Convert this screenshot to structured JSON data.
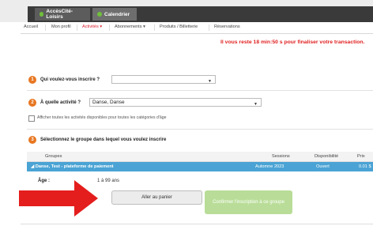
{
  "tabs": [
    {
      "label": "AccèsCité-Loisirs"
    },
    {
      "label": "Calendrier"
    }
  ],
  "menu": [
    {
      "label": "Accueil"
    },
    {
      "label": "Mon profil"
    },
    {
      "label": "Activités ▾"
    },
    {
      "label": "Abonnements ▾"
    },
    {
      "label": "Produits / Billetterie"
    },
    {
      "label": "Réservations"
    }
  ],
  "timer_text": "Il vous reste 18 min:50 s pour finaliser votre transaction.",
  "step1": {
    "number": "1",
    "label": "Qui voulez-vous inscrire ?",
    "value": ""
  },
  "step2": {
    "number": "2",
    "label": "À quelle activité ?",
    "value": "Danse, Danse"
  },
  "checkbox_label": "Afficher toutes les activités disponibles pour toutes les catégories d'âge",
  "step3": {
    "number": "3",
    "label": "Sélectionnez le groupe dans lequel vous voulez inscrire"
  },
  "table": {
    "headers": {
      "groupes": "Groupes",
      "sessions": "Sessions",
      "dispo": "Disponibilité",
      "prix": "Prix"
    },
    "row": {
      "name": "◢  Danse, Test - plateforme de paiement",
      "session": "Automne 2023",
      "dispo": "Ouvert",
      "prix": "0.01 $"
    }
  },
  "age": {
    "label": "Âge :",
    "value": "1 à 99 ans"
  },
  "buttons": {
    "panier": "Aller au panier",
    "confirm": "Confirmer l'inscription à ce groupe"
  },
  "colors": {
    "accent_orange": "#e87722",
    "row_blue": "#4aa3d4",
    "confirm_green": "#b9dd98",
    "arrow_red": "#e41d1d",
    "timer_red": "#e02020"
  }
}
